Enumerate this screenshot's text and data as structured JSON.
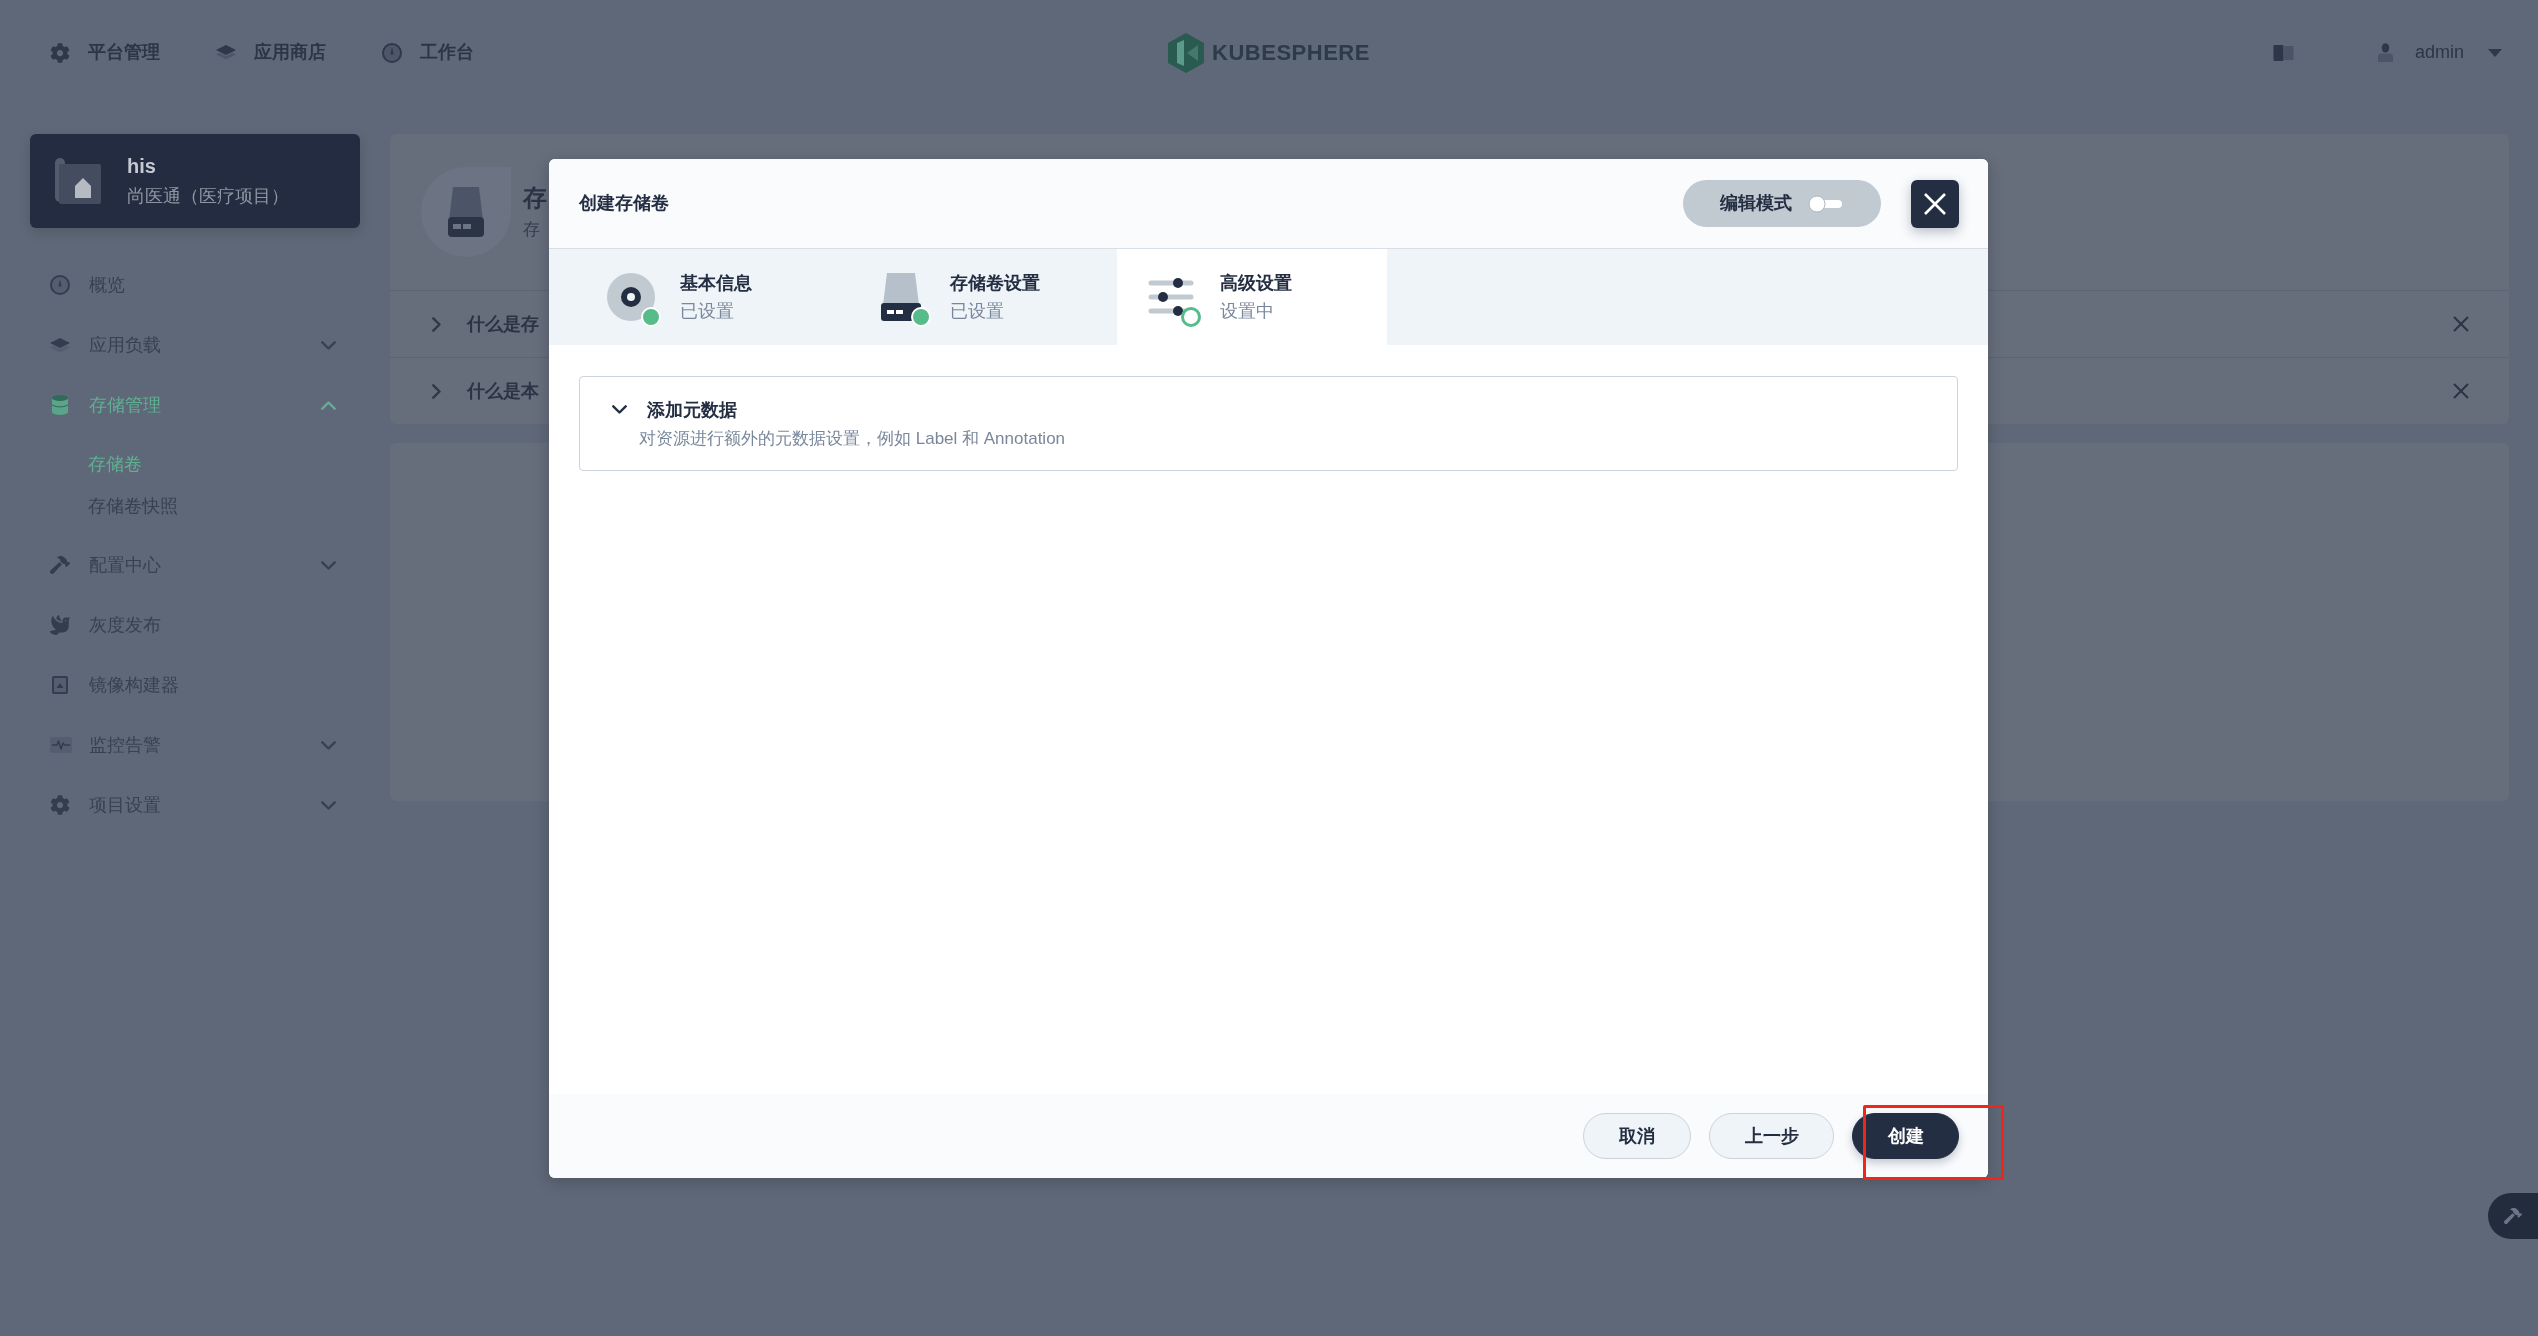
{
  "top_nav": {
    "items": [
      {
        "label": "平台管理"
      },
      {
        "label": "应用商店"
      },
      {
        "label": "工作台"
      }
    ],
    "logo": "KUBESPHERE",
    "user": "admin"
  },
  "sidebar": {
    "project": {
      "name": "his",
      "description": "尚医通（医疗项目）"
    },
    "items": [
      {
        "label": "概览",
        "kind": "link",
        "selected": false
      },
      {
        "label": "应用负载",
        "kind": "group",
        "selected": false,
        "expanded": false
      },
      {
        "label": "存储管理",
        "kind": "group",
        "selected": true,
        "expanded": true,
        "children": [
          {
            "label": "存储卷",
            "selected": true
          },
          {
            "label": "存储卷快照",
            "selected": false
          }
        ]
      },
      {
        "label": "配置中心",
        "kind": "group",
        "selected": false,
        "expanded": false
      },
      {
        "label": "灰度发布",
        "kind": "link",
        "selected": false
      },
      {
        "label": "镜像构建器",
        "kind": "link",
        "selected": false
      },
      {
        "label": "监控告警",
        "kind": "group",
        "selected": false,
        "expanded": false
      },
      {
        "label": "项目设置",
        "kind": "group",
        "selected": false,
        "expanded": false
      }
    ]
  },
  "page": {
    "banner": {
      "title": "存",
      "subtitle": "存"
    },
    "faq": [
      {
        "question": "什么是存"
      },
      {
        "question": "什么是本"
      }
    ]
  },
  "dialog": {
    "title": "创建存储卷",
    "edit_mode": {
      "label": "编辑模式",
      "on": false
    },
    "steps": [
      {
        "title": "基本信息",
        "status": "已设置",
        "selected": false,
        "done": true
      },
      {
        "title": "存储卷设置",
        "status": "已设置",
        "selected": false,
        "done": true
      },
      {
        "title": "高级设置",
        "status": "设置中",
        "selected": true,
        "done": false
      }
    ],
    "sections": [
      {
        "title": "添加元数据",
        "description": "对资源进行额外的元数据设置，例如 Label 和 Annotation",
        "expanded": false
      }
    ],
    "buttons": [
      {
        "label": "取消",
        "kind": "secondary"
      },
      {
        "label": "上一步",
        "kind": "secondary"
      },
      {
        "label": "创建",
        "kind": "primary"
      }
    ]
  }
}
